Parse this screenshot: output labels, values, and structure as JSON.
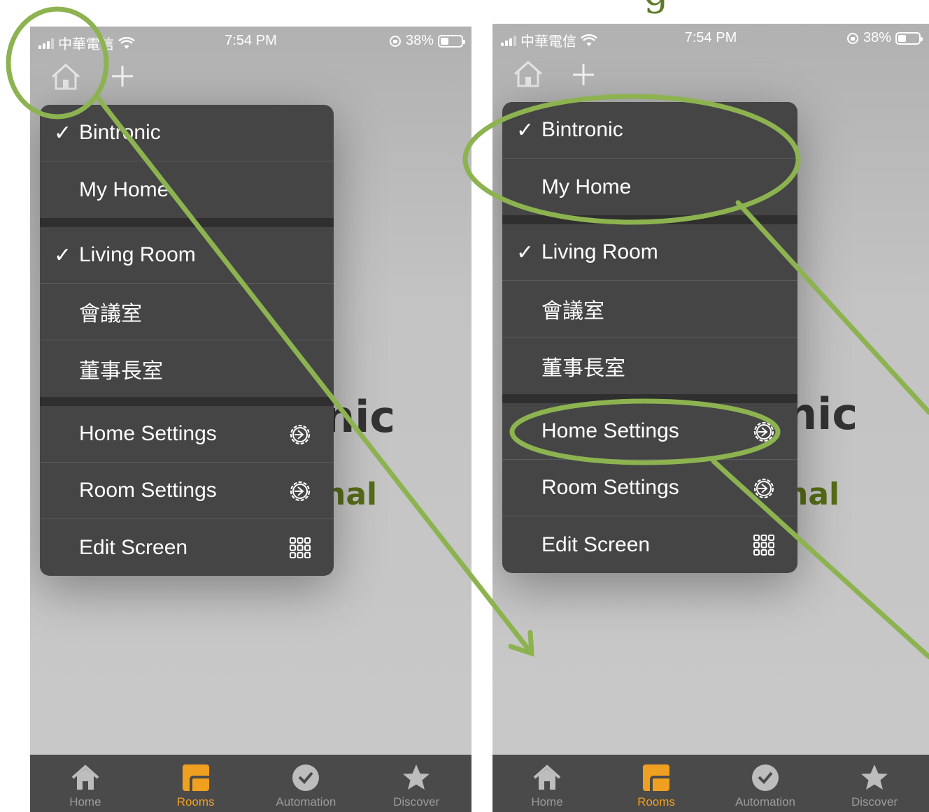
{
  "status_bar": {
    "carrier": "中華電信",
    "time": "7:54 PM",
    "battery_text": "38%",
    "battery_level": 0.38
  },
  "background": {
    "big_text_fragment": "nic",
    "green_text_fragment": "nal"
  },
  "menu": {
    "homes": [
      {
        "label": "Bintronic",
        "checked": true
      },
      {
        "label": "My Home",
        "checked": false
      }
    ],
    "rooms": [
      {
        "label": "Living Room",
        "checked": true
      },
      {
        "label": "會議室",
        "checked": false
      },
      {
        "label": "董事長室",
        "checked": false
      }
    ],
    "actions": [
      {
        "label": "Home Settings",
        "icon": "gear-icon"
      },
      {
        "label": "Room Settings",
        "icon": "gear-icon"
      },
      {
        "label": "Edit Screen",
        "icon": "grid-icon"
      }
    ],
    "check_glyph": "✓"
  },
  "tabbar": {
    "tabs": [
      {
        "label": "Home",
        "icon": "house-icon",
        "active": false
      },
      {
        "label": "Rooms",
        "icon": "rooms-icon",
        "active": true
      },
      {
        "label": "Automation",
        "icon": "clock-check-icon",
        "active": false
      },
      {
        "label": "Discover",
        "icon": "star-icon",
        "active": false
      }
    ]
  },
  "colors": {
    "annotation_green": "#8db350",
    "active_tab": "#f0a020",
    "menu_bg": "#454545"
  }
}
